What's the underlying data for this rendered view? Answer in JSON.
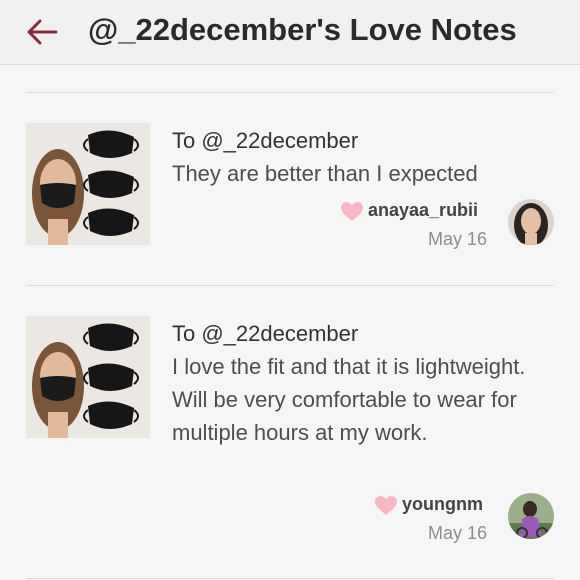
{
  "header": {
    "back_icon": "left-arrow-icon",
    "title": "@_22december's Love Notes"
  },
  "notes": [
    {
      "to": "To @_22december",
      "message": "They are better than I expected",
      "username": "anayaa_rubii",
      "date": "May 16"
    },
    {
      "to": "To @_22december",
      "message": "I love the fit and that it is lightweight. Will be very comfortable to wear for multiple hours at my work.",
      "username": "youngnm",
      "date": "May 16"
    }
  ],
  "colors": {
    "accent": "#8a2d3a",
    "heart": "#f6b8c4",
    "background": "#f7f6f6"
  }
}
